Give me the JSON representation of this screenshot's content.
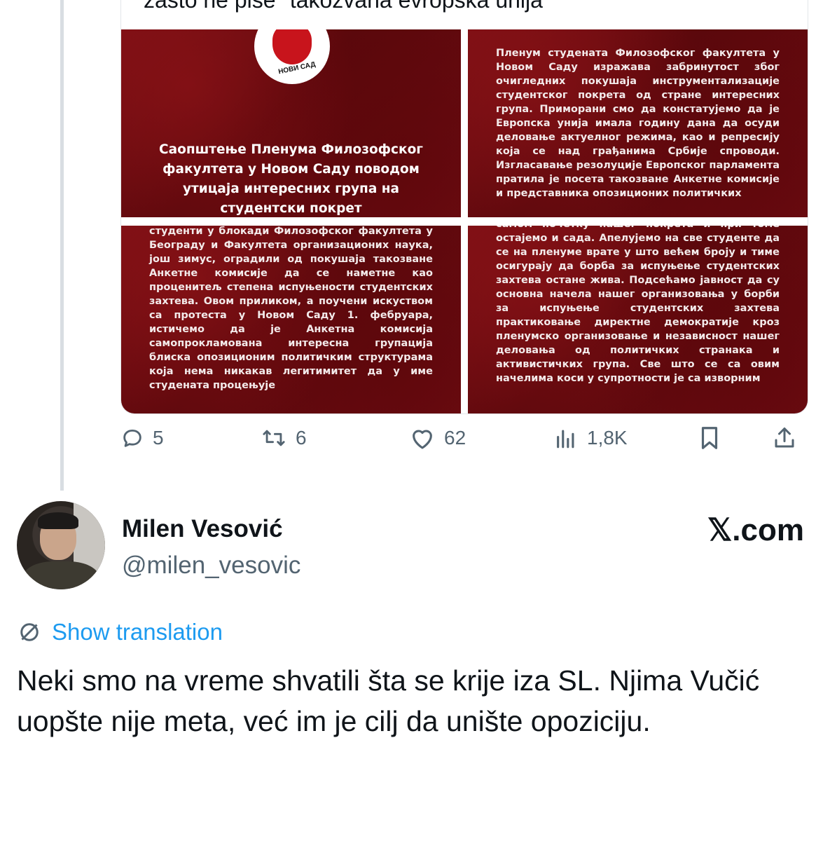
{
  "quoted": {
    "cut_title": "zašto ne piše \"takozvana evropska unija\"",
    "panel1": {
      "logo_text": "НОВИ САД",
      "title": "Саопштење Пленума Филозофског факултета у Новом Саду поводом утицаја интересних група на студентски покрет"
    },
    "panel2": {
      "text": "Пленум студената Филозофског факултета у Новом Саду изражава забринутост због очигледних покушаја инструментализације студентског покрета од стране интересних група. Приморани смо да констатујемо да је Европска унија имала годину дана да осуди деловање актуелног режима, као и репресију која се над грађанима Србије спроводи. Изгласавање резолуције Европског парламента пратила је посета такозване Анкетне комисије и представника опозиционих политичких"
    },
    "panel3": {
      "text": "студенти у блокади Филозофског факултета у Београду и Факултета организационих наука, још зимус, оградили од покушаја такозване Анкетне комисије да се наметне као проценитељ степена испуњености студентских захтева. Овом приликом, а поучени искуством са протеста у Новом Саду 1. фебруара, истичемо да је Анкетна комисија самопрокламована интересна групација блиска опозиционим политичким структурама која нема никакав легитимитет да у име студената процењује"
    },
    "panel4": {
      "text": "самом почетку нашег покрета и при томе остајемо и сада. Апелујемо на све студенте да се на пленуме врате у што већем броју и тиме осигурају да борба за испуњење студентских захтева остане жива. Подсећамо јавност да су основна начела нашег организовања у борби за испуњење студентских захтева практиковање директне демократије кроз пленумско организовање и независност нашег деловања од политичких странака и активистичких група. Све што се са овим начелима коси у супротности је са изворним"
    }
  },
  "actions": {
    "replies": "5",
    "reposts": "6",
    "likes": "62",
    "views": "1,8K"
  },
  "author": {
    "name": "Milen Vesović",
    "handle": "@milen_vesovic"
  },
  "brand": "𝕏.com",
  "translation_label": "Show translation",
  "tweet_text": "Neki smo na vreme shvatili šta se krije iza SL. Njima Vučić uopšte nije meta, već im je cilj da unište opoziciju.",
  "colors": {
    "link": "#1d9bf0",
    "muted": "#536471",
    "panel_red": "#6e0c11"
  }
}
